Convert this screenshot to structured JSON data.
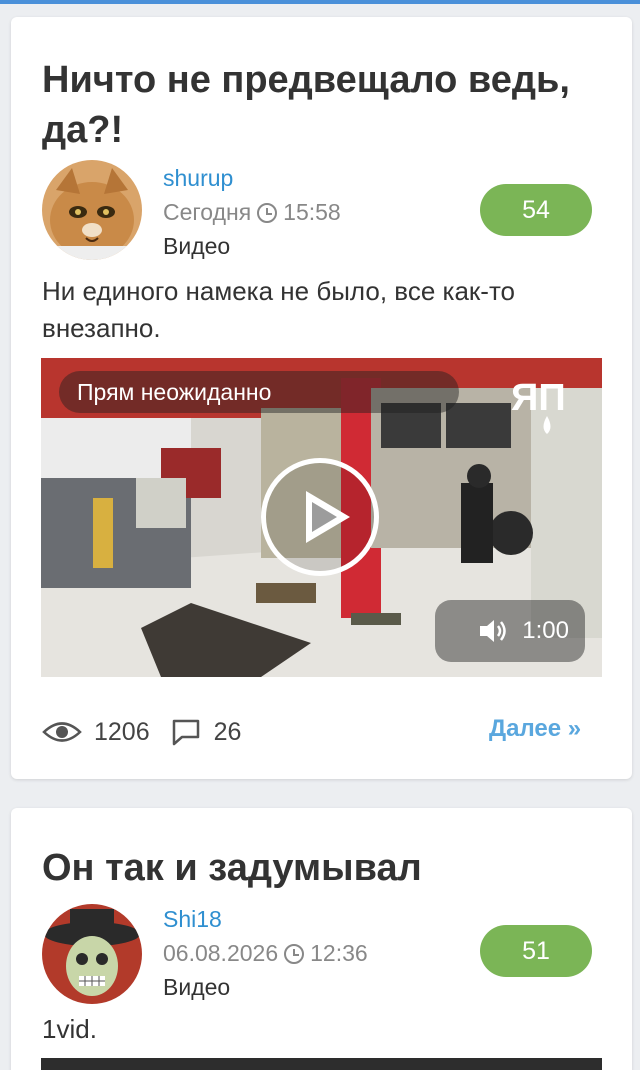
{
  "posts": [
    {
      "title": "Ничто не предвещало ведь, да?!",
      "author": "shurup",
      "date": "Сегодня",
      "time": "15:58",
      "category": "Видео",
      "rating": "54",
      "description": "Ни единого намека не было, все как-то внезапно.",
      "video": {
        "caption": "Прям неожиданно",
        "duration": "1:00",
        "logo": "ЯП"
      },
      "views": "1206",
      "comments": "26",
      "more_label": "Далее »"
    },
    {
      "title": "Он так и задумывал",
      "author": "Shi18",
      "date": "06.08.2026",
      "time": "12:36",
      "category": "Видео",
      "rating": "51",
      "description": "1vid."
    }
  ],
  "colors": {
    "accent": "#2f8fd0",
    "rating_bg": "#7bb556",
    "more_link": "#5aa7de"
  }
}
